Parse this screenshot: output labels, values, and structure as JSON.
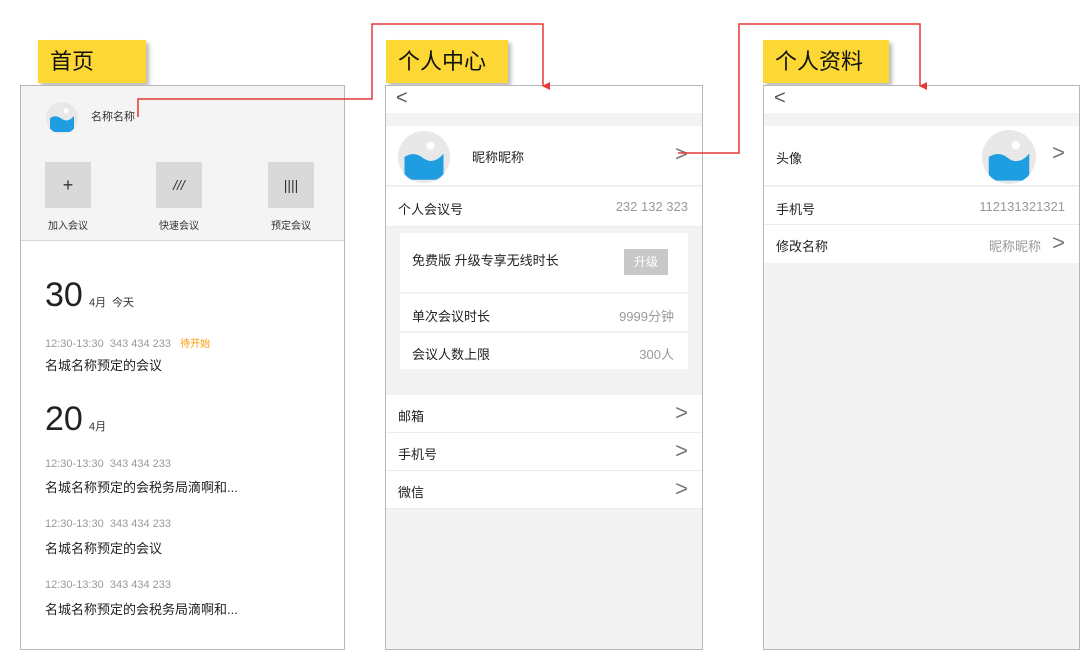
{
  "labels": {
    "home": "首页",
    "center": "个人中心",
    "profile": "个人资料"
  },
  "home": {
    "username": "名称名称",
    "quick": [
      {
        "icon": "+",
        "label": "加入会议"
      },
      {
        "icon": "///",
        "label": "快速会议"
      },
      {
        "icon": "||||",
        "label": "预定会议"
      }
    ],
    "day1": {
      "num": "30",
      "month": "4月",
      "today": "今天"
    },
    "meeting1": {
      "time": "12:30-13:30",
      "id": "343 434 233",
      "status": "待开始",
      "title": "名城名称预定的会议"
    },
    "day2": {
      "num": "20",
      "month": "4月"
    },
    "meeting2": {
      "time": "12:30-13:30",
      "id": "343 434 233",
      "title": "名城名称预定的会税务局滴啊和..."
    },
    "meeting3": {
      "time": "12:30-13:30",
      "id": "343 434 233",
      "title": "名城名称预定的会议"
    },
    "meeting4": {
      "time": "12:30-13:30",
      "id": "343 434 233",
      "title": "名城名称预定的会税务局滴啊和..."
    }
  },
  "center": {
    "back": "<",
    "nickname": "昵称昵称",
    "chevron": ">",
    "meeting_no_label": "个人会议号",
    "meeting_no": "232 132 323",
    "plan_text": "免费版 升级专享无线时长",
    "upgrade": "升级",
    "duration_label": "单次会议时长",
    "duration": "9999分钟",
    "limit_label": "会议人数上限",
    "limit": "300人",
    "email": "邮箱",
    "phone": "手机号",
    "wechat": "微信"
  },
  "profile": {
    "back": "<",
    "avatar_label": "头像",
    "phone_label": "手机号",
    "phone": "112131321321",
    "rename_label": "修改名称",
    "rename_value": "昵称昵称"
  },
  "colors": {
    "tag": "#fdd835",
    "connector": "#e53935",
    "status": "#ff9800",
    "avatar_sky": "#1e9ee0"
  }
}
